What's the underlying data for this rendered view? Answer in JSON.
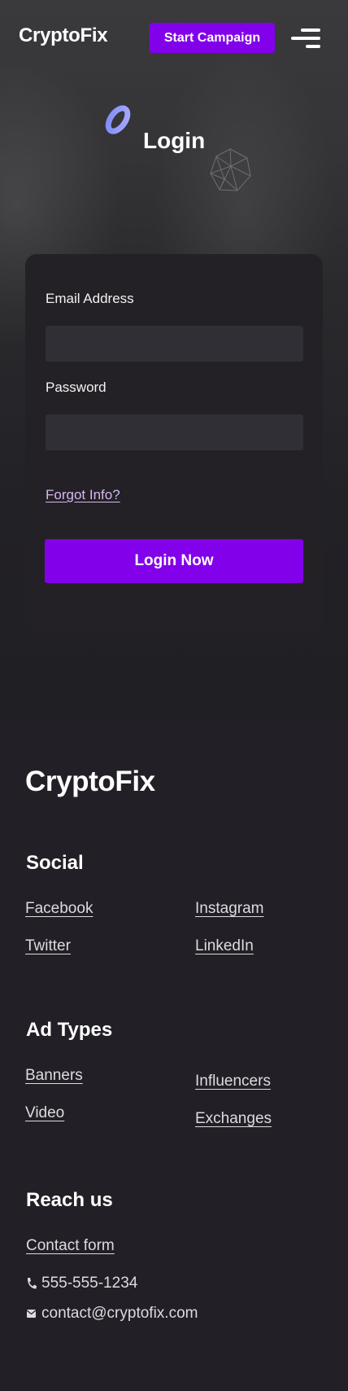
{
  "header": {
    "brand": "CryptoFix",
    "cta_label": "Start Campaign",
    "menu_icon": "hamburger-menu-icon"
  },
  "hero": {
    "title": "Login",
    "decorations": [
      "ring-icon",
      "polyhedron-icon"
    ]
  },
  "login_form": {
    "email_label": "Email Address",
    "email_value": "",
    "password_label": "Password",
    "password_value": "",
    "forgot_label": "Forgot Info?",
    "submit_label": "Login Now"
  },
  "footer": {
    "brand": "CryptoFix",
    "social": {
      "heading": "Social",
      "links": [
        "Facebook",
        "Instagram",
        "Twitter",
        "LinkedIn"
      ]
    },
    "ad_types": {
      "heading": "Ad Types",
      "links": [
        "Banners",
        "Influencers",
        "Video",
        "Exchanges"
      ]
    },
    "reach": {
      "heading": "Reach us",
      "contact_form": "Contact form",
      "phone": "555-555-1234",
      "email": "contact@cryptofix.com"
    }
  },
  "colors": {
    "accent": "#8300ea",
    "background": "#222026",
    "card": "#232126",
    "input": "#312f36",
    "link_light": "#d6b7f0"
  }
}
